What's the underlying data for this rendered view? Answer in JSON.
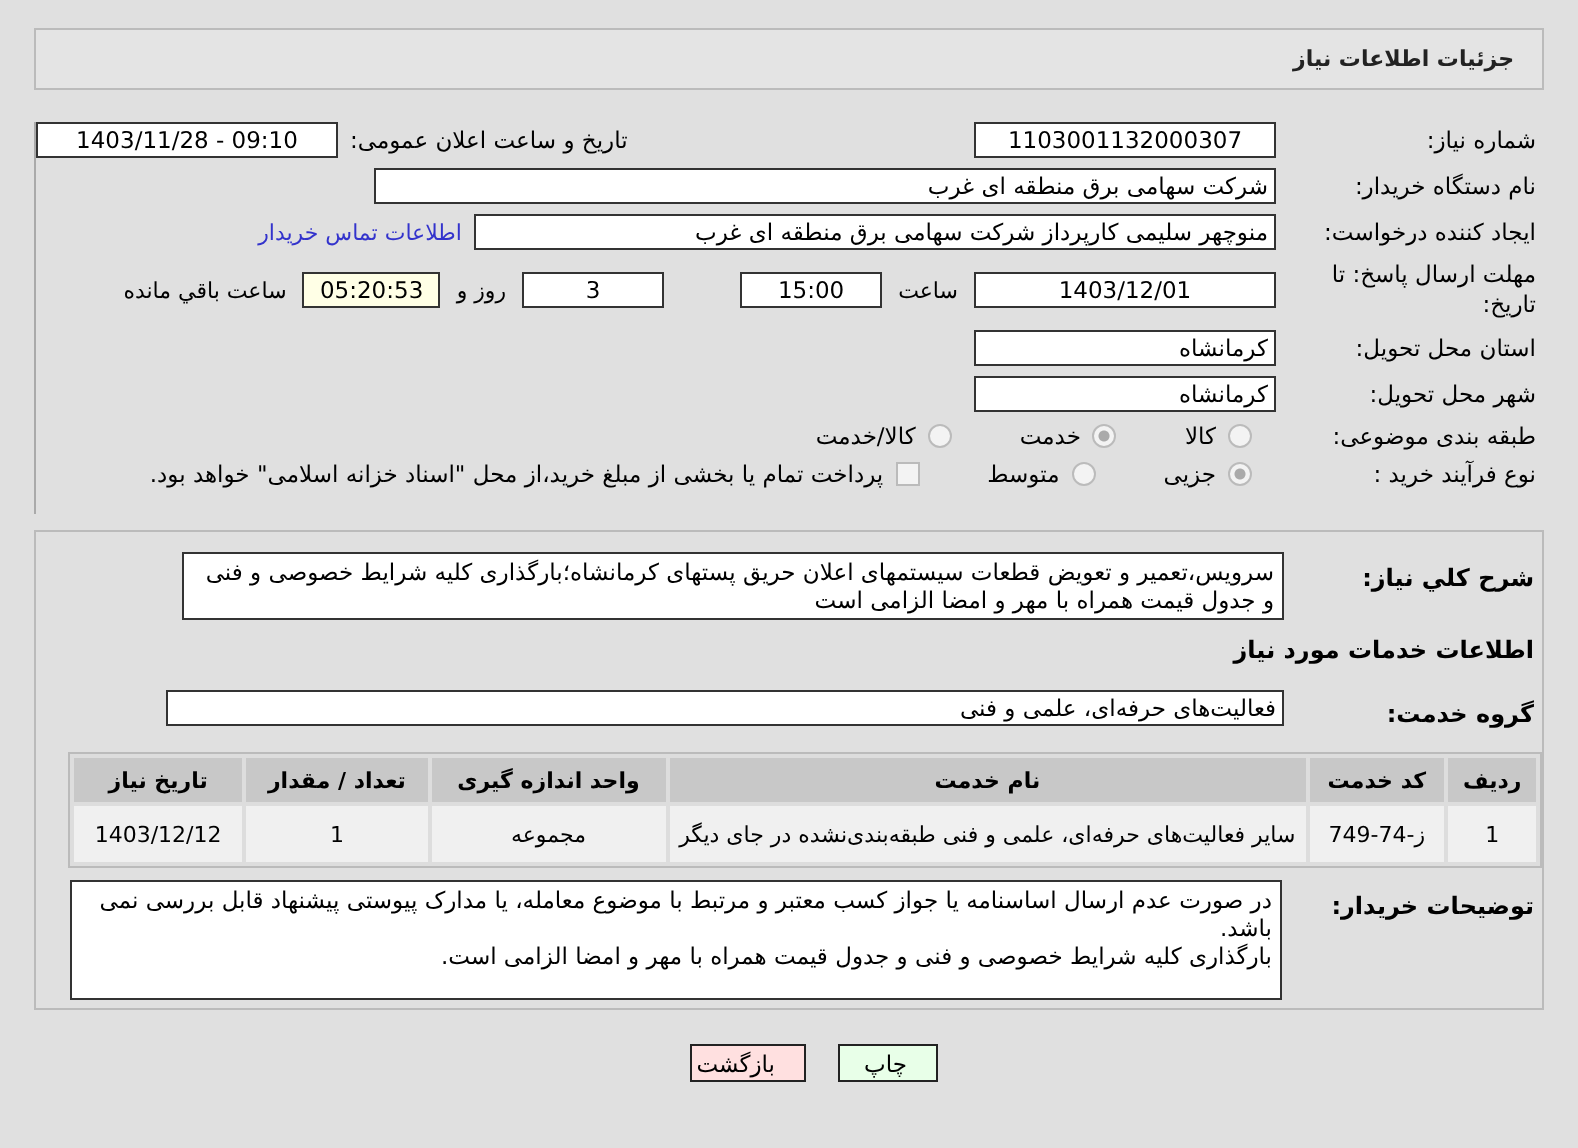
{
  "header": {
    "title": "جزئیات اطلاعات نیاز"
  },
  "fields": {
    "need_number": {
      "label": "شماره نیاز:",
      "value": "1103001132000307"
    },
    "announce": {
      "label": "تاریخ و ساعت اعلان عمومی:",
      "value": "1403/11/28 - 09:10"
    },
    "buyer": {
      "label": "نام دستگاه خریدار:",
      "value": "شرکت سهامی برق منطقه ای غرب"
    },
    "creator": {
      "label": "ایجاد کننده درخواست:",
      "value": "منوچهر  سلیمی کارپرداز شرکت سهامی برق منطقه ای غرب",
      "link": "اطلاعات تماس خریدار"
    },
    "deadline": {
      "label": "مهلت ارسال پاسخ: تا تاریخ:",
      "date": "1403/12/01",
      "time_label": "ساعت",
      "time": "15:00",
      "days": "3",
      "days_label": "روز و",
      "remaining": "05:20:53",
      "remaining_label": "ساعت باقي مانده"
    },
    "province": {
      "label": "استان محل تحویل:",
      "value": "کرمانشاه"
    },
    "city": {
      "label": "شهر محل تحویل:",
      "value": "کرمانشاه"
    }
  },
  "category": {
    "label": "طبقه بندی موضوعی:",
    "options": [
      {
        "label": "کالا",
        "selected": false
      },
      {
        "label": "خدمت",
        "selected": true
      },
      {
        "label": "کالا/خدمت",
        "selected": false
      }
    ]
  },
  "process": {
    "label": "نوع فرآیند خرید :",
    "options": [
      {
        "label": "جزیی",
        "selected": true
      },
      {
        "label": "متوسط",
        "selected": false
      }
    ],
    "treasury": {
      "checked": false,
      "label": "پرداخت تمام یا بخشی از مبلغ خرید،از محل \"اسناد خزانه اسلامی\" خواهد بود."
    }
  },
  "description": {
    "label": "شرح کلي نیاز:",
    "value": "سرویس،تعمیر و تعویض قطعات سیستمهای اعلان حریق پستهای کرمانشاه؛بارگذاری کلیه شرایط خصوصی و فنی و جدول قیمت همراه با مهر و امضا الزامی است"
  },
  "services_heading": "اطلاعات خدمات مورد نیاز",
  "service_group": {
    "label": "گروه خدمت:",
    "value": "فعالیت‌های حرفه‌ای، علمی و فنی"
  },
  "table": {
    "columns": [
      "ردیف",
      "کد خدمت",
      "نام خدمت",
      "واحد اندازه گیری",
      "تعداد / مقدار",
      "تاریخ نیاز"
    ],
    "rows": [
      [
        "1",
        "ز-74-749",
        "سایر فعالیت‌های حرفه‌ای، علمی و فنی طبقه‌بندی‌نشده در جای دیگر",
        "مجموعه",
        "1",
        "1403/12/12"
      ]
    ]
  },
  "buyer_notes": {
    "label": "توضیحات خریدار:",
    "lines": [
      "در صورت عدم ارسال اساسنامه یا جواز کسب معتبر و مرتبط با موضوع معامله،  یا مدارک پیوستی پیشنهاد قابل بررسی نمی باشد.",
      "بارگذاری کلیه شرایط خصوصی و فنی و جدول قیمت همراه با مهر و امضا الزامی است."
    ]
  },
  "buttons": [
    {
      "label": "چاپ",
      "kind": "print"
    },
    {
      "label": "بازگشت",
      "kind": "back"
    }
  ]
}
